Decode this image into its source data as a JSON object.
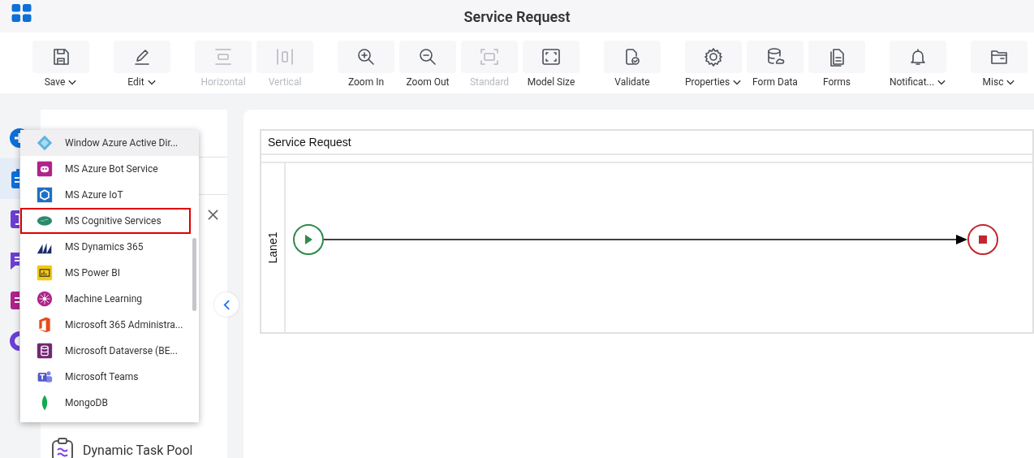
{
  "window": {
    "title": "Service Request"
  },
  "toolbar": [
    {
      "label": "Save",
      "disabled": false,
      "has_menu": true
    },
    {
      "label": "Edit",
      "disabled": false,
      "has_menu": true
    },
    {
      "label": "Horizontal",
      "disabled": true,
      "has_menu": false
    },
    {
      "label": "Vertical",
      "disabled": true,
      "has_menu": false
    },
    {
      "label": "Zoom In",
      "disabled": false,
      "has_menu": false
    },
    {
      "label": "Zoom Out",
      "disabled": false,
      "has_menu": false
    },
    {
      "label": "Standard",
      "disabled": true,
      "has_menu": false
    },
    {
      "label": "Model Size",
      "disabled": false,
      "has_menu": false
    },
    {
      "label": "Validate",
      "disabled": false,
      "has_menu": false
    },
    {
      "label": "Properties",
      "disabled": false,
      "has_menu": true
    },
    {
      "label": "Form Data",
      "disabled": false,
      "has_menu": false
    },
    {
      "label": "Forms",
      "disabled": false,
      "has_menu": false
    },
    {
      "label": "Notificat...",
      "disabled": false,
      "has_menu": true
    },
    {
      "label": "Misc",
      "disabled": false,
      "has_menu": true
    }
  ],
  "library": {
    "item": "Dynamic Task Pool"
  },
  "dropdown": [
    {
      "label": "Window Azure Active Dir...",
      "hovered": true,
      "outlined": false
    },
    {
      "label": "MS Azure Bot Service",
      "hovered": false,
      "outlined": false
    },
    {
      "label": "MS Azure IoT",
      "hovered": false,
      "outlined": false
    },
    {
      "label": "MS Cognitive Services",
      "hovered": false,
      "outlined": true
    },
    {
      "label": "MS Dynamics 365",
      "hovered": false,
      "outlined": false
    },
    {
      "label": "MS Power BI",
      "hovered": false,
      "outlined": false
    },
    {
      "label": "Machine Learning",
      "hovered": false,
      "outlined": false
    },
    {
      "label": "Microsoft 365 Administra...",
      "hovered": false,
      "outlined": false
    },
    {
      "label": "Microsoft Dataverse (BE...",
      "hovered": false,
      "outlined": false
    },
    {
      "label": "Microsoft Teams",
      "hovered": false,
      "outlined": false
    },
    {
      "label": "MongoDB",
      "hovered": false,
      "outlined": false
    }
  ],
  "diagram": {
    "pool": "Service Request",
    "lanes": [
      {
        "label": "Lane1"
      }
    ]
  }
}
